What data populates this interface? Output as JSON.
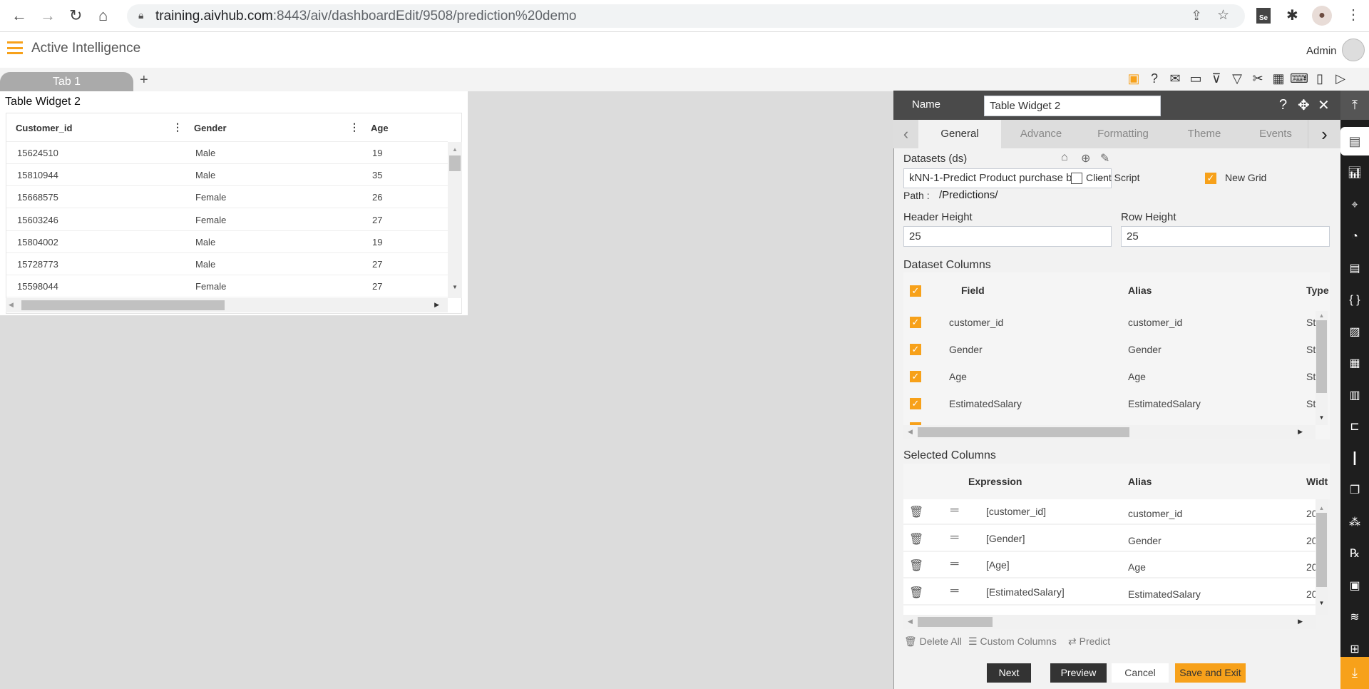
{
  "browser": {
    "url_host": "training.aivhub.com",
    "url_rest": ":8443/aiv/dashboardEdit/9508/prediction%20demo",
    "ext_label": "Se"
  },
  "app": {
    "title": "Active Intelligence",
    "user": "Admin"
  },
  "tabs": {
    "items": [
      {
        "label": "Tab 1"
      }
    ],
    "add": "+"
  },
  "toolbar_icons": [
    "save-icon",
    "help-icon",
    "mail-icon",
    "comment-icon",
    "clear-filter-icon",
    "filter-icon",
    "tools-icon",
    "table-icon",
    "code-icon",
    "devices-icon",
    "play-icon"
  ],
  "widget": {
    "title": "Table Widget 2",
    "columns": [
      "Customer_id",
      "Gender",
      "Age"
    ],
    "rows": [
      [
        "15624510",
        "Male",
        "19"
      ],
      [
        "15810944",
        "Male",
        "35"
      ],
      [
        "15668575",
        "Female",
        "26"
      ],
      [
        "15603246",
        "Female",
        "27"
      ],
      [
        "15804002",
        "Male",
        "19"
      ],
      [
        "15728773",
        "Male",
        "27"
      ],
      [
        "15598044",
        "Female",
        "27"
      ]
    ]
  },
  "panel": {
    "name_label": "Name",
    "name_value": "Table Widget 2",
    "tabs": [
      "General",
      "Advance",
      "Formatting",
      "Theme",
      "Events"
    ],
    "active_tab": "General",
    "datasets_label": "Datasets (ds)",
    "dataset_value": "kNN-1-Predict Product purchase b...",
    "client_script": {
      "label": "Client Script",
      "checked": false
    },
    "new_grid": {
      "label": "New Grid",
      "checked": true
    },
    "path_label": "Path :",
    "path_value": "/Predictions/",
    "header_height_label": "Header Height",
    "header_height": "25",
    "row_height_label": "Row Height",
    "row_height": "25",
    "dataset_columns_label": "Dataset Columns",
    "dataset_headers": [
      "Field",
      "Alias",
      "Type"
    ],
    "dataset_rows": [
      {
        "field": "customer_id",
        "alias": "customer_id",
        "type": "St"
      },
      {
        "field": "Gender",
        "alias": "Gender",
        "type": "St"
      },
      {
        "field": "Age",
        "alias": "Age",
        "type": "St"
      },
      {
        "field": "EstimatedSalary",
        "alias": "EstimatedSalary",
        "type": "St"
      }
    ],
    "selected_columns_label": "Selected Columns",
    "selected_headers": [
      "Expression",
      "Alias",
      "Widt"
    ],
    "selected_rows": [
      {
        "expr": "[customer_id]",
        "alias": "customer_id",
        "width": "20"
      },
      {
        "expr": "[Gender]",
        "alias": "Gender",
        "width": "20"
      },
      {
        "expr": "[Age]",
        "alias": "Age",
        "width": "20"
      },
      {
        "expr": "[EstimatedSalary]",
        "alias": "EstimatedSalary",
        "width": "20"
      }
    ],
    "links": {
      "delete_all": "Delete All",
      "custom_columns": "Custom Columns",
      "predict": "Predict"
    },
    "buttons": {
      "next": "Next",
      "preview": "Preview",
      "cancel": "Cancel",
      "save_exit": "Save and Exit"
    }
  },
  "colors": {
    "accent": "#f7a11a",
    "dark": "#4a4a4a",
    "rail": "#1e1e1e"
  }
}
